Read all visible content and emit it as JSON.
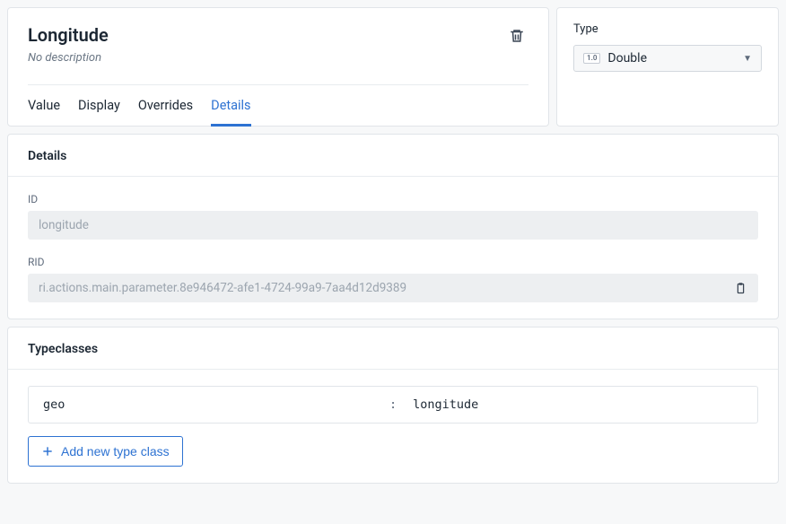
{
  "header": {
    "title": "Longitude",
    "description": "No description",
    "tabs": [
      {
        "label": "Value",
        "active": false
      },
      {
        "label": "Display",
        "active": false
      },
      {
        "label": "Overrides",
        "active": false
      },
      {
        "label": "Details",
        "active": true
      }
    ]
  },
  "type_panel": {
    "label": "Type",
    "badge": "1.0",
    "selected": "Double"
  },
  "details": {
    "section_title": "Details",
    "id_label": "ID",
    "id_value": "longitude",
    "rid_label": "RID",
    "rid_value": "ri.actions.main.parameter.8e946472-afe1-4724-99a9-7aa4d12d9389"
  },
  "typeclasses": {
    "section_title": "Typeclasses",
    "rows": [
      {
        "key": "geo",
        "value": "longitude"
      }
    ],
    "add_label": "Add new type class"
  }
}
